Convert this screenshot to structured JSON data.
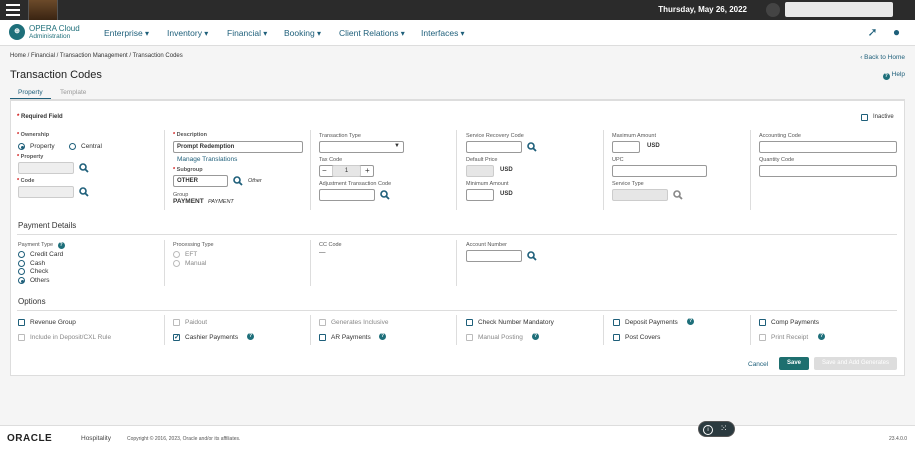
{
  "topbar": {
    "date": "Thursday, May 26, 2022"
  },
  "brand": {
    "title": "OPERA Cloud",
    "subtitle": "Administration"
  },
  "nav": {
    "items": [
      "Enterprise",
      "Inventory",
      "Financial",
      "Booking",
      "Client Relations",
      "Interfaces"
    ]
  },
  "breadcrumb": "Home / Financial / Transaction Management / Transaction Codes",
  "back_home": "Back to Home",
  "page_title": "Transaction Codes",
  "help": "Help",
  "tabs": [
    "Property",
    "Template"
  ],
  "form": {
    "required_field": "Required Field",
    "inactive": "Inactive",
    "ownership_label": "Ownership",
    "ownership_options": [
      "Property",
      "Central"
    ],
    "property_label": "Property",
    "code_label": "Code",
    "description_label": "Description",
    "description_value": "Prompt Redemption",
    "manage_translations": "Manage Translations",
    "subgroup_label": "Subgroup",
    "subgroup_value": "OTHER",
    "subgroup_desc": "Other",
    "group_label": "Group",
    "group_value": "PAYMENT",
    "group_desc": "PAYMENT",
    "transaction_type_label": "Transaction Type",
    "tax_code_label": "Tax Code",
    "tax_code_value": "1",
    "adjustment_label": "Adjustment Transaction Code",
    "service_recovery_label": "Service Recovery Code",
    "default_price_label": "Default Price",
    "minimum_amount_label": "Minimum Amount",
    "maximum_amount_label": "Maximum Amount",
    "upc_label": "UPC",
    "service_type_label": "Service Type",
    "accounting_code_label": "Accounting Code",
    "quantity_code_label": "Quantity Code",
    "usd": "USD"
  },
  "payment": {
    "title": "Payment Details",
    "payment_type_label": "Payment Type",
    "payment_types": [
      "Credit Card",
      "Cash",
      "Check",
      "Others"
    ],
    "processing_type_label": "Processing Type",
    "processing_types": [
      "EFT",
      "Manual"
    ],
    "cc_code_label": "CC Code",
    "cc_code_value": "—",
    "account_number_label": "Account Number"
  },
  "options": {
    "title": "Options",
    "row1": [
      "Revenue Group",
      "Paidout",
      "Generates Inclusive",
      "Check Number Mandatory",
      "Deposit Payments",
      "Comp Payments"
    ],
    "row2": [
      "Include in Deposit/CXL Rule",
      "Cashier Payments",
      "AR Payments",
      "Manual Posting",
      "Post Covers",
      "Print Receipt"
    ]
  },
  "buttons": {
    "cancel": "Cancel",
    "save": "Save",
    "save_add": "Save and Add Generates"
  },
  "footer": {
    "oracle": "ORACLE",
    "hospitality": "Hospitality",
    "copyright": "Copyright © 2016, 2023, Oracle and/or its affiliates.",
    "version": "23.4.0.0"
  },
  "colors": {
    "accent": "#1e5f7a",
    "topbar": "#2b2b2b"
  }
}
